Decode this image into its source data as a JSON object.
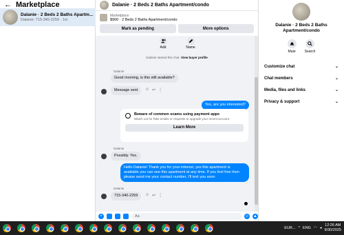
{
  "left": {
    "title": "Marketplace",
    "conversation": {
      "name": "Dalanie · 2 Beds 2 Baths Apartm...",
      "sub": "Dalanie: 715-340-2259 · 1m"
    }
  },
  "chat": {
    "header_name": "Dalanie · 2 Beds 2 Baths Apartment/condo",
    "listing_label": "Marketplace",
    "listing_price": "$900 · 2 Beds 2 Baths Apartment/condo",
    "mark_pending": "Mark as pending",
    "more_options": "More options",
    "actions": [
      {
        "label": "Add",
        "icon": "add-person-icon"
      },
      {
        "label": "Name",
        "icon": "pencil-icon"
      }
    ],
    "system_prefix": "Dalanie started this chat.",
    "system_link": "View buyer profile",
    "messages": {
      "sender1": "Dalanie",
      "m1": "Good morning, is this still available?",
      "m2": "Message sent",
      "m3": "Yes, are you interested?",
      "sender2": "Dalanie",
      "m4": "Possibly. Yes.",
      "m5": "Hello Dalanie! Thank you for your interest, yes this apartment is available you can see this apartment at any time. If you feel free then please send me your contact number, I'll text you soon",
      "sender3": "Dalanie",
      "m6": "715-340-2259"
    },
    "scam_card": {
      "title": "Beware of common scams using payment apps",
      "sub": "Watch out for fake emails or requests to upgrade your recent account.",
      "button": "Learn More"
    },
    "composer_placeholder": "Aa"
  },
  "right": {
    "name": "Dalanie · 2 Beds 2 Baths Apartment/condo",
    "mute": "Mute",
    "search": "Search",
    "sections": [
      "Customize chat",
      "Chat members",
      "Media, files and links",
      "Privacy & support"
    ]
  },
  "taskbar": {
    "currency": "EUR...",
    "lang": "ENG",
    "time": "12:26 AM",
    "date": "9/30/2025"
  },
  "colors": {
    "accent": "#0084ff",
    "selected": "#dfeaf7"
  }
}
